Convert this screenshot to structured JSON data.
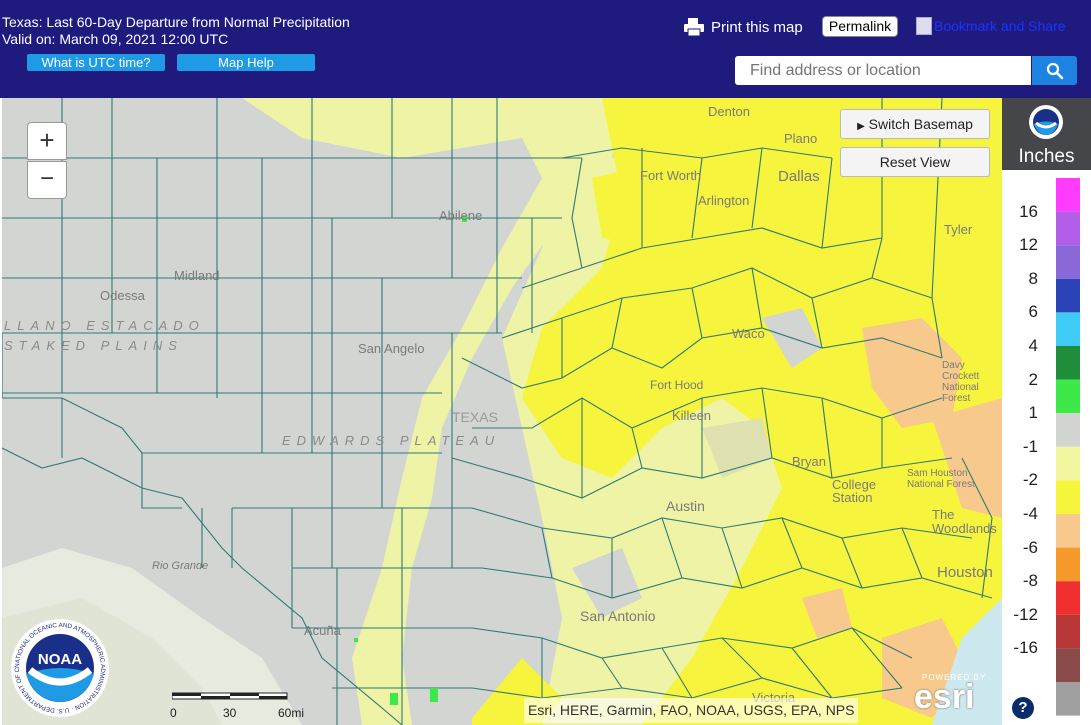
{
  "header": {
    "title_line1": "Texas: Last 60-Day Departure from Normal Precipitation",
    "title_line2": "Valid on: March 09, 2021 12:00 UTC",
    "utc_button": "What is UTC time?",
    "help_button": "Map Help",
    "print_label": "Print this map",
    "permalink_label": "Permalink",
    "bookmark_label": "Bookmark and Share",
    "search_placeholder": "Find address or location"
  },
  "map": {
    "zoom_in": "+",
    "zoom_out": "−",
    "switch_basemap": "Switch Basemap",
    "reset_view": "Reset View",
    "attribution": "Esri, HERE, Garmin, FAO, NOAA, USGS, EPA, NPS",
    "scale_labels": [
      "0",
      "30",
      "60mi"
    ],
    "logo_text": "NOAA",
    "logo_ring_text": "NATIONAL OCEANIC AND ATMOSPHERIC ADMINISTRATION · U.S. DEPARTMENT OF COMMERCE",
    "esri_powered": "POWERED BY",
    "esri_text": "esri",
    "places": [
      {
        "name": "Denton",
        "key": "denton"
      },
      {
        "name": "Plano",
        "key": "plano"
      },
      {
        "name": "Fort Worth",
        "key": "fortworth"
      },
      {
        "name": "Dallas",
        "key": "dallas"
      },
      {
        "name": "Arlington",
        "key": "arlington"
      },
      {
        "name": "Abilene",
        "key": "abilene"
      },
      {
        "name": "Tyler",
        "key": "tyler"
      },
      {
        "name": "Midland",
        "key": "midland"
      },
      {
        "name": "Odessa",
        "key": "odessa"
      },
      {
        "name": "San Angelo",
        "key": "sanangelo"
      },
      {
        "name": "Waco",
        "key": "waco"
      },
      {
        "name": "Fort Hood",
        "key": "forthood"
      },
      {
        "name": "Killeen",
        "key": "killeen"
      },
      {
        "name": "TEXAS",
        "key": "texas"
      },
      {
        "name": "Bryan",
        "key": "bryan"
      },
      {
        "name": "College Station",
        "key": "collegestation"
      },
      {
        "name": "Austin",
        "key": "austin"
      },
      {
        "name": "The Woodlands",
        "key": "woodlands"
      },
      {
        "name": "Houston",
        "key": "houston"
      },
      {
        "name": "San Antonio",
        "key": "sanantonio"
      },
      {
        "name": "Acuña",
        "key": "acuna"
      },
      {
        "name": "Rio Grande",
        "key": "riogrande"
      },
      {
        "name": "Victoria",
        "key": "victoria"
      },
      {
        "name": "Davy Crockett National Forest",
        "key": "davycrockett"
      },
      {
        "name": "Sam Houston National Forest",
        "key": "samhouston"
      }
    ],
    "regions": [
      {
        "name": "LLANO ESTACADO",
        "key": "llano"
      },
      {
        "name": "STAKED PLAINS",
        "key": "staked"
      },
      {
        "name": "EDWARDS PLATEAU",
        "key": "edwards"
      }
    ]
  },
  "legend": {
    "unit": "Inches",
    "ticks": [
      "16",
      "12",
      "8",
      "6",
      "4",
      "2",
      "1",
      "-1",
      "-2",
      "-4",
      "-6",
      "-8",
      "-12",
      "-16"
    ],
    "colors": [
      "#ff3cff",
      "#b35ee8",
      "#8a68d8",
      "#2a44b8",
      "#3ecbf5",
      "#1f8d3a",
      "#3ee848",
      "#d2d4d2",
      "#f2f7a0",
      "#f5f53c",
      "#f7c98c",
      "#f59a2a",
      "#f03030",
      "#b83838",
      "#8a4a4a",
      "#a0a0a0"
    ]
  },
  "help_icon": "?"
}
